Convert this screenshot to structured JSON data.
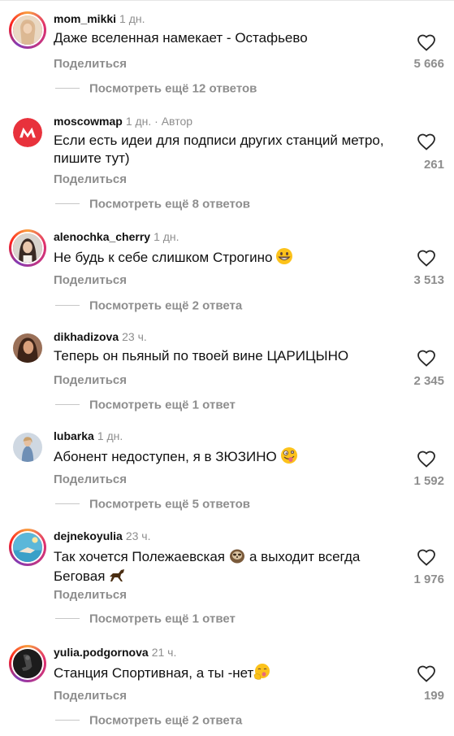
{
  "share_label": "Поделиться",
  "comments": [
    {
      "username": "mom_mikki",
      "meta": "1 дн.",
      "text": "Даже вселенная намекает - Остафьево",
      "likes": "5 666",
      "replies": "Посмотреть ещё 12 ответов",
      "avatar_color": "#d9b38c"
    },
    {
      "username": "moscowmap",
      "meta": "1 дн. · Автор",
      "text": "Если есть идеи для подписи других станций метро, пишите тут)",
      "likes": "261",
      "replies": "Посмотреть ещё 8 ответов",
      "avatar_color": "#e8323c"
    },
    {
      "username": "alenochka_cherry",
      "meta": "1 дн.",
      "text": "Не будь к себе слишком Строгино",
      "emoji": "grinning-face",
      "likes": "3 513",
      "replies": "Посмотреть ещё 2 ответа",
      "avatar_color": "#3a2a24"
    },
    {
      "username": "dikhadizova",
      "meta": "23 ч.",
      "text": "Теперь он пьяный по твоей вине ЦАРИЦЫНО",
      "likes": "2 345",
      "replies": "Посмотреть ещё 1 ответ",
      "avatar_color": "#5a3422"
    },
    {
      "username": "lubarka",
      "meta": "1 дн.",
      "text": "Абонент недоступен, я в ЗЮЗИНО",
      "emoji": "zany-face",
      "likes": "1 592",
      "replies": "Посмотреть ещё 5 ответов",
      "avatar_color": "#6f8fb5"
    },
    {
      "username": "dejnekoyulia",
      "meta": "23 ч.",
      "text": "Так хочется Полежаевская",
      "text_mid": "а выходит всегда Беговая",
      "emoji": "sloth",
      "emoji_end": "racehorse",
      "likes": "1 976",
      "replies": "Посмотреть ещё 1 ответ",
      "avatar_color": "#5bb7d9"
    },
    {
      "username": "yulia.podgornova",
      "meta": "21 ч.",
      "text": "Станция Спортивная, а ты -нет",
      "emoji": "face-with-tongue-hand",
      "likes": "199",
      "replies": "Посмотреть ещё 2 ответа",
      "avatar_color": "#1c1c1c"
    }
  ]
}
